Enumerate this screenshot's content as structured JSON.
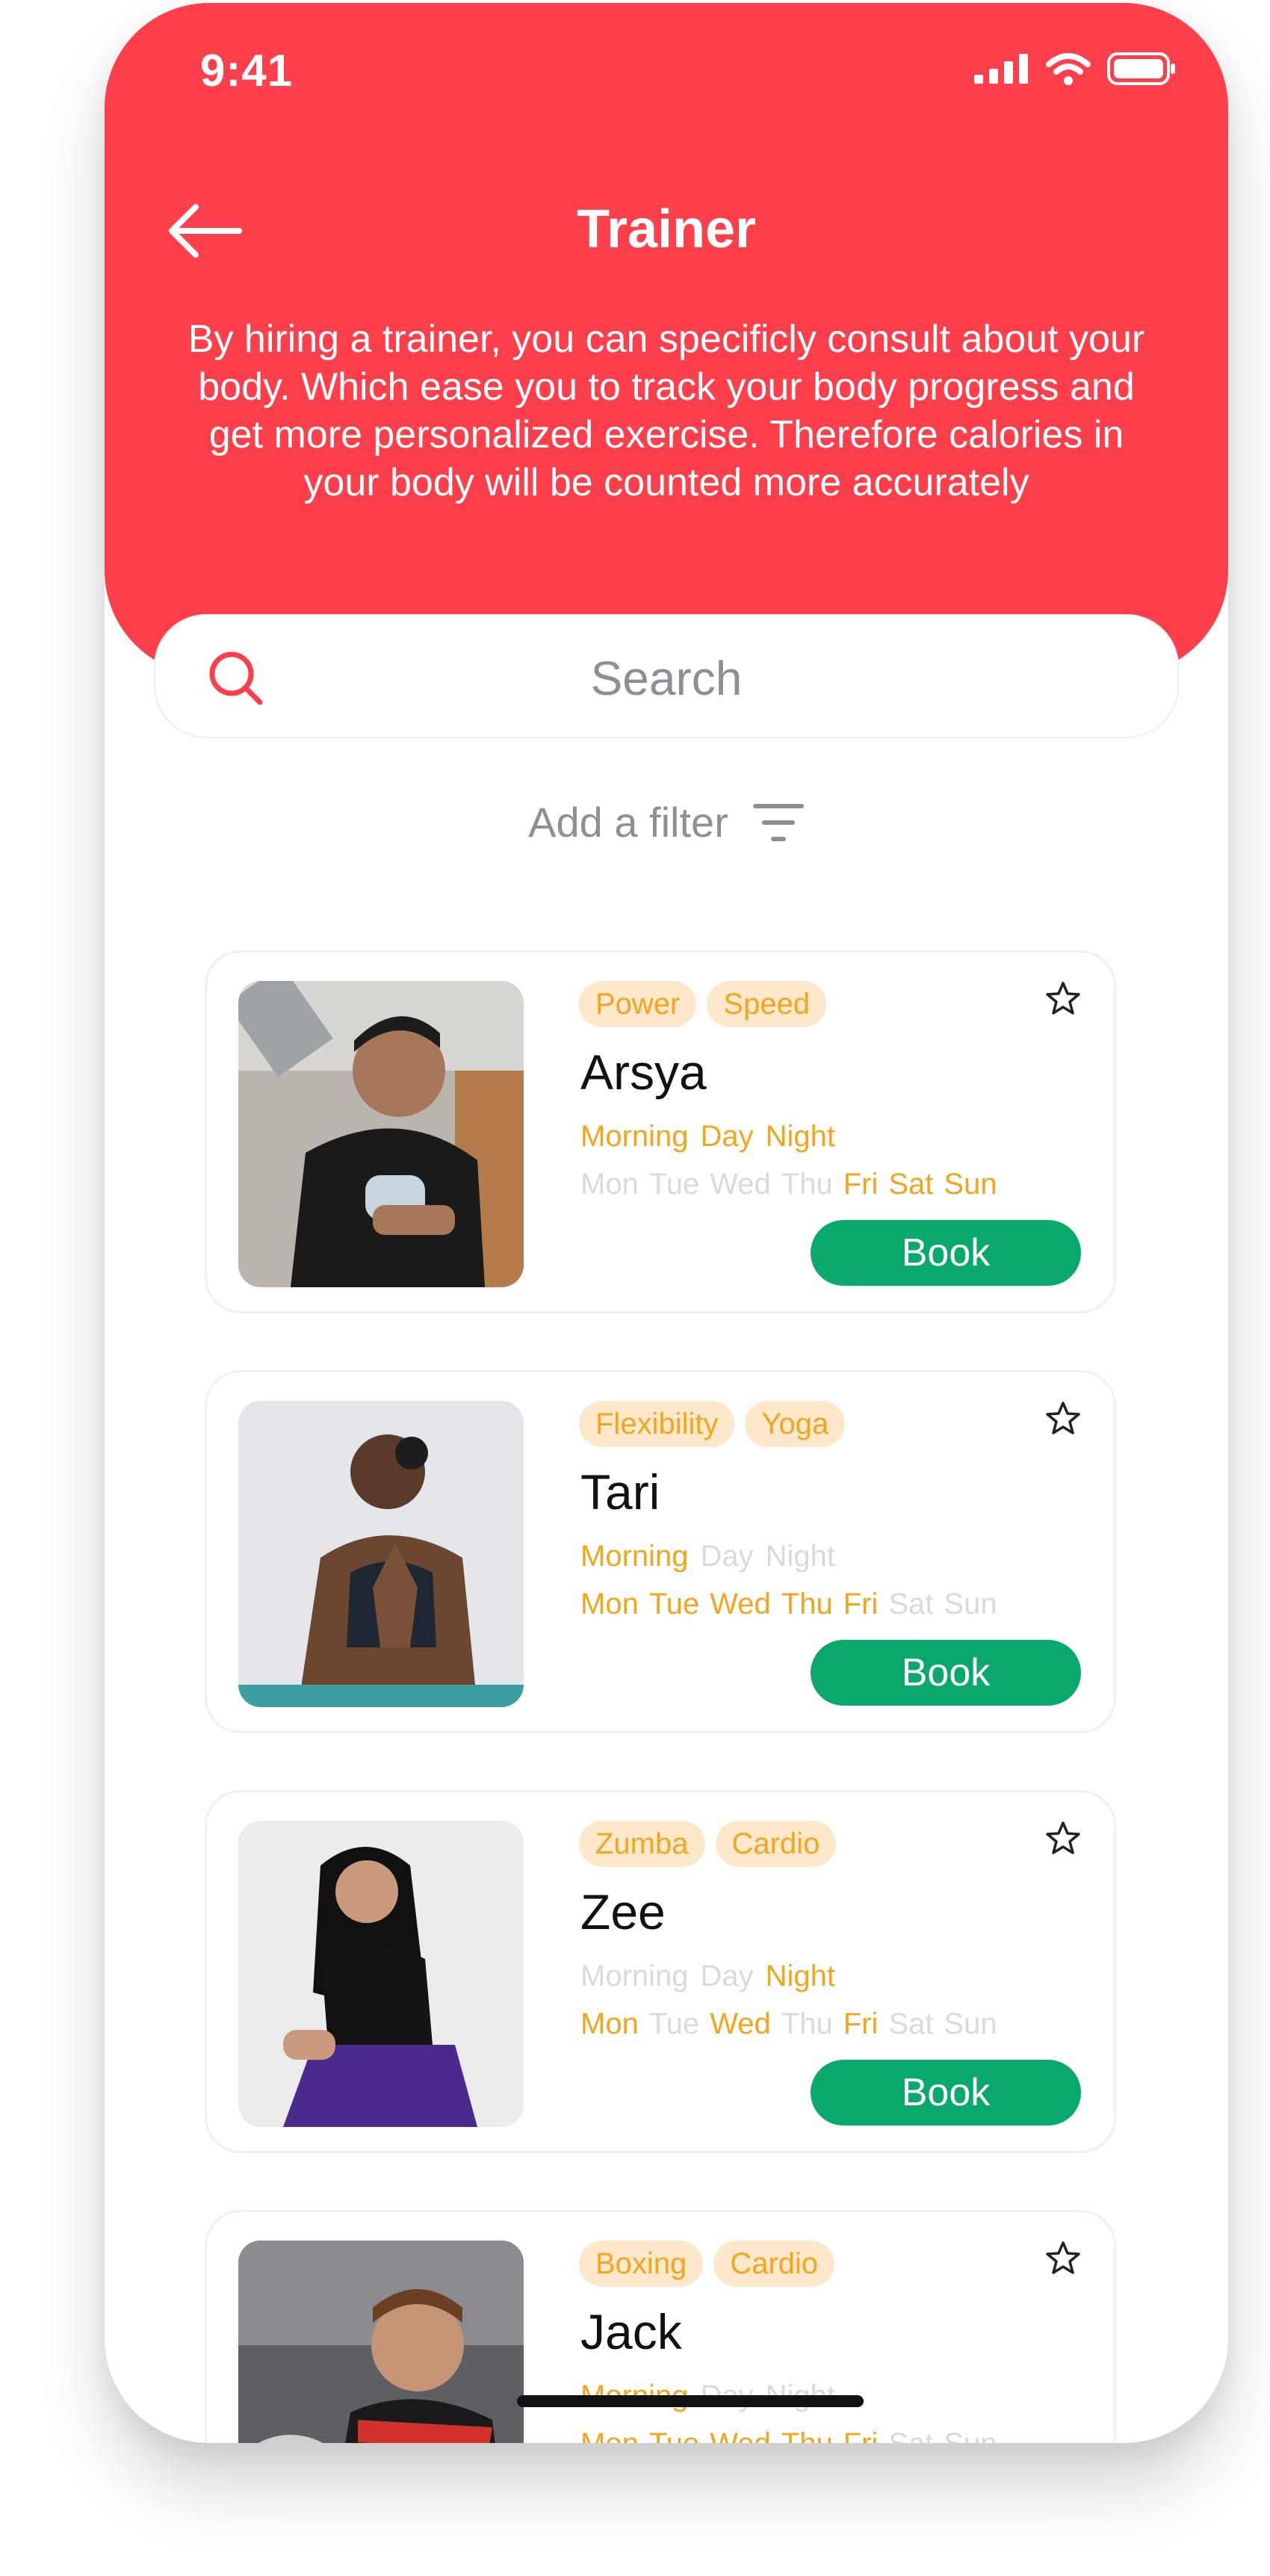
{
  "status_bar": {
    "time": "9:41"
  },
  "header": {
    "title": "Trainer",
    "description": "By hiring a trainer, you can specificly consult about your body. Which ease you to track your body progress and get more personalized exercise. Therefore calories in your body will be counted more accurately"
  },
  "search": {
    "placeholder": "Search"
  },
  "filter": {
    "label": "Add a filter"
  },
  "colors": {
    "header_red": "#fd3f4b",
    "book_green": "#08a96a",
    "tag_orange": "#f3a61d",
    "tag_bg": "#fde8cc",
    "inactive": "#d9dadd"
  },
  "book_label": "Book",
  "trainers": [
    {
      "name": "Arsya",
      "tags": [
        "Power",
        "Speed"
      ],
      "times": [
        {
          "label": "Morning",
          "on": true
        },
        {
          "label": "Day",
          "on": true
        },
        {
          "label": "Night",
          "on": true
        }
      ],
      "days": [
        {
          "label": "Mon",
          "on": false
        },
        {
          "label": "Tue",
          "on": false
        },
        {
          "label": "Wed",
          "on": false
        },
        {
          "label": "Thu",
          "on": false
        },
        {
          "label": "Fri",
          "on": true
        },
        {
          "label": "Sat",
          "on": true
        },
        {
          "label": "Sun",
          "on": true
        }
      ]
    },
    {
      "name": "Tari",
      "tags": [
        "Flexibility",
        "Yoga"
      ],
      "times": [
        {
          "label": "Morning",
          "on": true
        },
        {
          "label": "Day",
          "on": false
        },
        {
          "label": "Night",
          "on": false
        }
      ],
      "days": [
        {
          "label": "Mon",
          "on": true
        },
        {
          "label": "Tue",
          "on": true
        },
        {
          "label": "Wed",
          "on": true
        },
        {
          "label": "Thu",
          "on": true
        },
        {
          "label": "Fri",
          "on": true
        },
        {
          "label": "Sat",
          "on": false
        },
        {
          "label": "Sun",
          "on": false
        }
      ]
    },
    {
      "name": "Zee",
      "tags": [
        "Zumba",
        "Cardio"
      ],
      "times": [
        {
          "label": "Morning",
          "on": false
        },
        {
          "label": "Day",
          "on": false
        },
        {
          "label": "Night",
          "on": true
        }
      ],
      "days": [
        {
          "label": "Mon",
          "on": true
        },
        {
          "label": "Tue",
          "on": false
        },
        {
          "label": "Wed",
          "on": true
        },
        {
          "label": "Thu",
          "on": false
        },
        {
          "label": "Fri",
          "on": true
        },
        {
          "label": "Sat",
          "on": false
        },
        {
          "label": "Sun",
          "on": false
        }
      ]
    },
    {
      "name": "Jack",
      "tags": [
        "Boxing",
        "Cardio"
      ],
      "times": [
        {
          "label": "Morning",
          "on": true
        },
        {
          "label": "Day",
          "on": false
        },
        {
          "label": "Night",
          "on": false
        }
      ],
      "days": [
        {
          "label": "Mon",
          "on": true
        },
        {
          "label": "Tue",
          "on": true
        },
        {
          "label": "Wed",
          "on": true
        },
        {
          "label": "Thu",
          "on": true
        },
        {
          "label": "Fri",
          "on": true
        },
        {
          "label": "Sat",
          "on": false
        },
        {
          "label": "Sun",
          "on": false
        }
      ]
    }
  ]
}
